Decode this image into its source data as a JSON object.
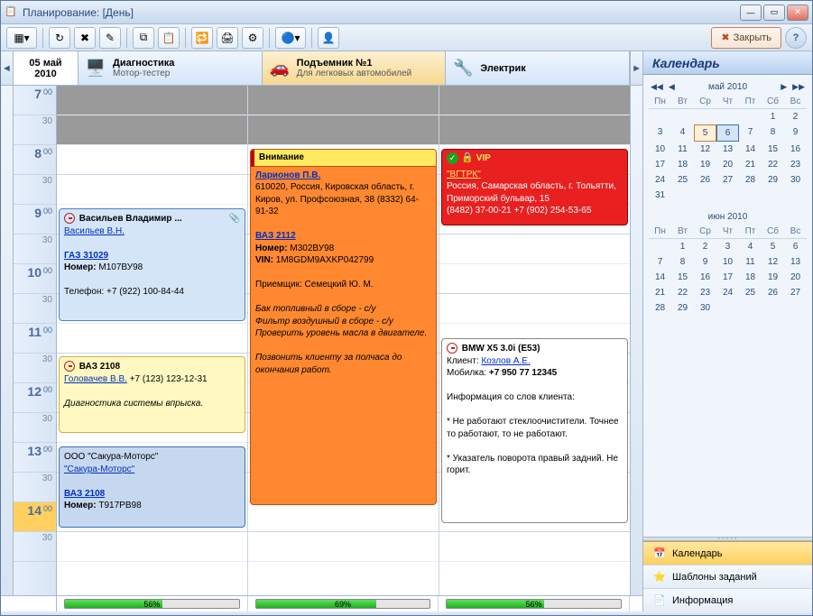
{
  "window": {
    "title": "Планирование: [День]"
  },
  "toolbar": {
    "close_label": "Закрыть"
  },
  "date_header": {
    "day": "05 май",
    "year": "2010"
  },
  "resources": [
    {
      "title": "Диагностика",
      "subtitle": "Мотор-тестер",
      "icon": "🖥️"
    },
    {
      "title": "Подъемник №1",
      "subtitle": "Для легковых автомобилей",
      "icon": "🚗"
    },
    {
      "title": "Электрик",
      "subtitle": "",
      "icon": "🔧"
    }
  ],
  "time_rows": [
    "7:00",
    "30",
    "8:00",
    "30",
    "9:00",
    "30",
    "10:00",
    "30",
    "11:00",
    "30",
    "12:00",
    "30",
    "13:00",
    "30",
    "14:00",
    "30"
  ],
  "appointments": {
    "vasilev": {
      "title": "Васильев Владимир ...",
      "client": "Васильев В.Н.",
      "vehicle": "ГАЗ 31029",
      "number_label": "Номер:",
      "number": "М107ВУ98",
      "phone_label": "Телефон:",
      "phone": "+7 (922) 100-84-44"
    },
    "vaz2108": {
      "vehicle": "ВАЗ 2108",
      "client": "Головачев В.В.",
      "phone": "+7 (123) 123-12-31",
      "note": "Диагностика системы впрыска."
    },
    "sakura": {
      "org": "ООО \"Сакура-Моторс\"",
      "link": "\"Сакура-Моторс\"",
      "vehicle": "ВАЗ 2108",
      "number_label": "Номер:",
      "number": "Т917РВ98"
    },
    "vnimanie": {
      "header": "Внимание",
      "client": "Ларионов П.В.",
      "address": "610020, Россия, Кировская область, г. Киров, ул. Профсоюзная, 38 (8332) 64-91-32",
      "vehicle": "ВАЗ 2112",
      "number_label": "Номер:",
      "number": "М302ВУ98",
      "vin_label": "VIN:",
      "vin": "1M8GDM9AXKP042799",
      "receiver_label": "Приемщик:",
      "receiver": "Семецкий Ю. М.",
      "works": "Бак топливный в сборе - с/у\nФильтр воздушный в сборе - с/у\nПроверить уровень масла в двигателе.",
      "footer": "Позвонить клиенту за полчаса до окончания работ."
    },
    "vip": {
      "badge": "VIP",
      "link": "\"ВГТРК\"",
      "address": "Россия, Самарская область, г. Тольятти, Приморский бульвар, 15",
      "phones": "(8482) 37-00-21 +7 (902) 254-53-65"
    },
    "bmw": {
      "title": "BMW X5 3.0i (E53)",
      "client_label": "Клиент:",
      "client": "Козлов А.Е.",
      "mobile_label": "Мобилка:",
      "mobile": "+7 950 77 12345",
      "info_header": "Информация со слов клиента:",
      "note1": "* Не работают стеклоочистители. Точнее то работают, то не работают.",
      "note2": "* Указатель поворота правый задний. Не горит."
    }
  },
  "load": [
    {
      "pct": "56%",
      "width": "56%"
    },
    {
      "pct": "69%",
      "width": "69%"
    },
    {
      "pct": "56%",
      "width": "56%"
    }
  ],
  "sidebar": {
    "header": "Календарь",
    "months": [
      {
        "label": "май 2010",
        "dow": [
          "Пн",
          "Вт",
          "Ср",
          "Чт",
          "Пт",
          "Сб",
          "Вс"
        ],
        "leading_blanks": 5,
        "days": [
          1,
          2,
          3,
          4,
          5,
          6,
          7,
          8,
          9,
          10,
          11,
          12,
          13,
          14,
          15,
          16,
          17,
          18,
          19,
          20,
          21,
          22,
          23,
          24,
          25,
          26,
          27,
          28,
          29,
          30,
          31
        ],
        "today": 5,
        "selected": 6
      },
      {
        "label": "июн 2010",
        "dow": [
          "Пн",
          "Вт",
          "Ср",
          "Чт",
          "Пт",
          "Сб",
          "Вс"
        ],
        "leading_blanks": 1,
        "days": [
          1,
          2,
          3,
          4,
          5,
          6,
          7,
          8,
          9,
          10,
          11,
          12,
          13,
          14,
          15,
          16,
          17,
          18,
          19,
          20,
          21,
          22,
          23,
          24,
          25,
          26,
          27,
          28,
          29,
          30
        ]
      }
    ],
    "tabs": [
      {
        "label": "Календарь",
        "icon": "📅",
        "active": true
      },
      {
        "label": "Шаблоны заданий",
        "icon": "📝",
        "active": false
      },
      {
        "label": "Информация",
        "icon": "📄",
        "active": false
      }
    ]
  }
}
